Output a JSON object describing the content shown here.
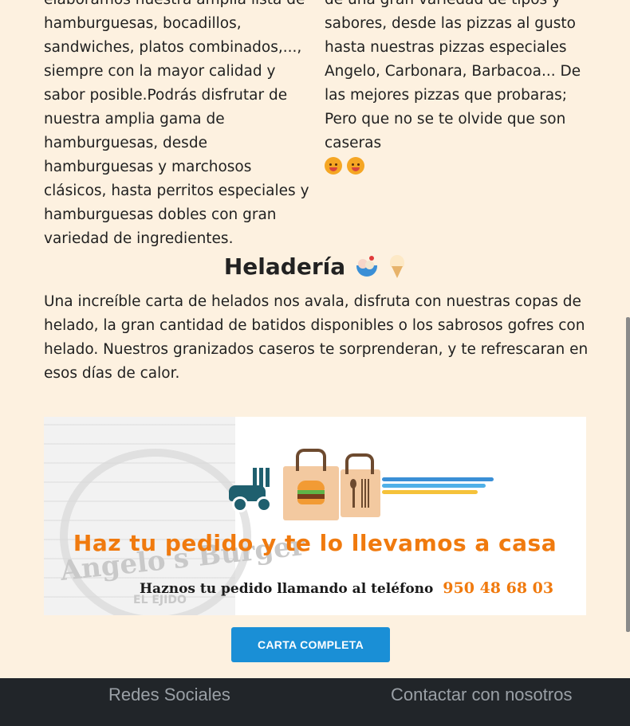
{
  "services": {
    "left_text": "elaboramos nuestra amplia lista de hamburguesas, bocadillos, sandwiches, platos combinados,..., siempre con la mayor calidad y sabor posible.Podrás disfrutar de nuestra amplia gama de hamburguesas, desde hamburguesas y marchosos clásicos, hasta perritos especiales y hamburguesas dobles con gran variedad de ingredientes.",
    "right_text": "de una gran variedad de tipos y sabores, desde las pizzas al gusto hasta nuestras pizzas especiales Angelo, Carbonara, Barbacoa... De las mejores pizzas que probaras; Pero que no se te olvide que son caseras",
    "right_emojis": [
      "tongue-face-icon",
      "yum-face-icon"
    ]
  },
  "heladeria": {
    "title": "Heladería",
    "icons": [
      "ice-cream-bowl-icon",
      "soft-serve-icon"
    ],
    "text": "Una increíble carta de helados nos avala, disfruta con nuestras copas de helado, la gran cantidad de batidos disponibles o los sabrosos gofres con helado. Nuestros granizados caseros te sorprenderan, y te refrescaran en esos días de calor."
  },
  "banner": {
    "logo_text": "Angelo's Burger",
    "logo_sub": "EL EJIDO",
    "title": "Haz tu pedido y te lo llevamos a casa",
    "phone_label": "Haznos tu pedido llamando al teléfono",
    "phone_number": "950 48 68 03",
    "colors": {
      "orange": "#f07a0e",
      "teal": "#1f5f6e",
      "blue_stripe": "#3a8fd6",
      "yellow_stripe": "#f5c23a"
    }
  },
  "cta": {
    "label": "CARTA COMPLETA",
    "color": "#1a8fd6"
  },
  "footer": {
    "left_heading": "Redes Sociales",
    "right_heading": "Contactar con nosotros",
    "background": "#212529"
  }
}
